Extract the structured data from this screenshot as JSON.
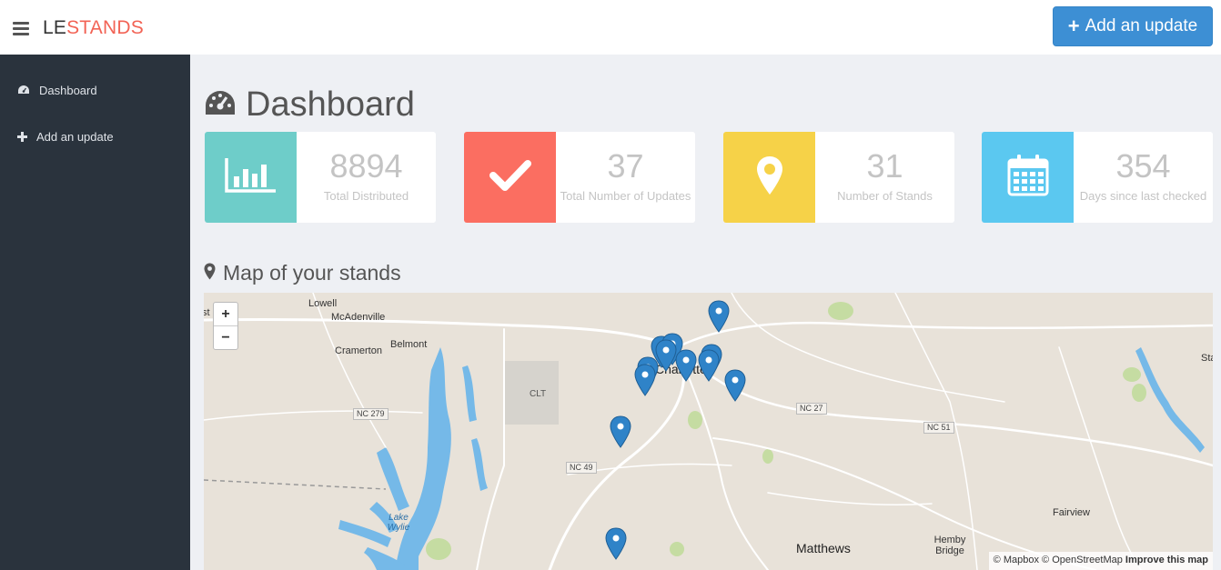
{
  "header": {
    "brand_part1": "LE",
    "brand_part2": "STANDS",
    "add_update_label": "Add an update",
    "add_update_icon": "plus-icon"
  },
  "sidebar": {
    "items": [
      {
        "label": "Dashboard",
        "icon": "dashboard-icon"
      },
      {
        "label": "Add an update",
        "icon": "plus-icon"
      }
    ]
  },
  "main": {
    "title": "Dashboard",
    "title_icon": "dashboard-icon",
    "stats": [
      {
        "value": "8894",
        "label": "Total Distributed",
        "color": "#6ecdc9",
        "icon": "bar-chart-icon"
      },
      {
        "value": "37",
        "label": "Total Number of Updates",
        "color": "#fb6e61",
        "icon": "checkmark-icon"
      },
      {
        "value": "31",
        "label": "Number of Stands",
        "color": "#f6d248",
        "icon": "map-marker-icon"
      },
      {
        "value": "354",
        "label": "Days since last checked",
        "color": "#5bc8f0",
        "icon": "calendar-icon"
      }
    ],
    "map_title": "Map of your stands",
    "map_title_icon": "map-marker-icon"
  },
  "map": {
    "zoom_in": "+",
    "zoom_out": "−",
    "places": [
      "Lowell",
      "McAdenville",
      "Belmont",
      "Cramerton",
      "CLT",
      "Lake Wylie",
      "Matthews",
      "Fairview",
      "Hemby Bridge",
      "Sta",
      "st"
    ],
    "city_label": "Charlotte",
    "shields": [
      "NC 279",
      "NC 49",
      "NC 27",
      "NC 51"
    ],
    "attribution_1": "© Mapbox",
    "attribution_2": "© OpenStreetMap",
    "attribution_3": "Improve this map",
    "marker_color": "#2f83c8",
    "water_color": "#75b9e8"
  }
}
